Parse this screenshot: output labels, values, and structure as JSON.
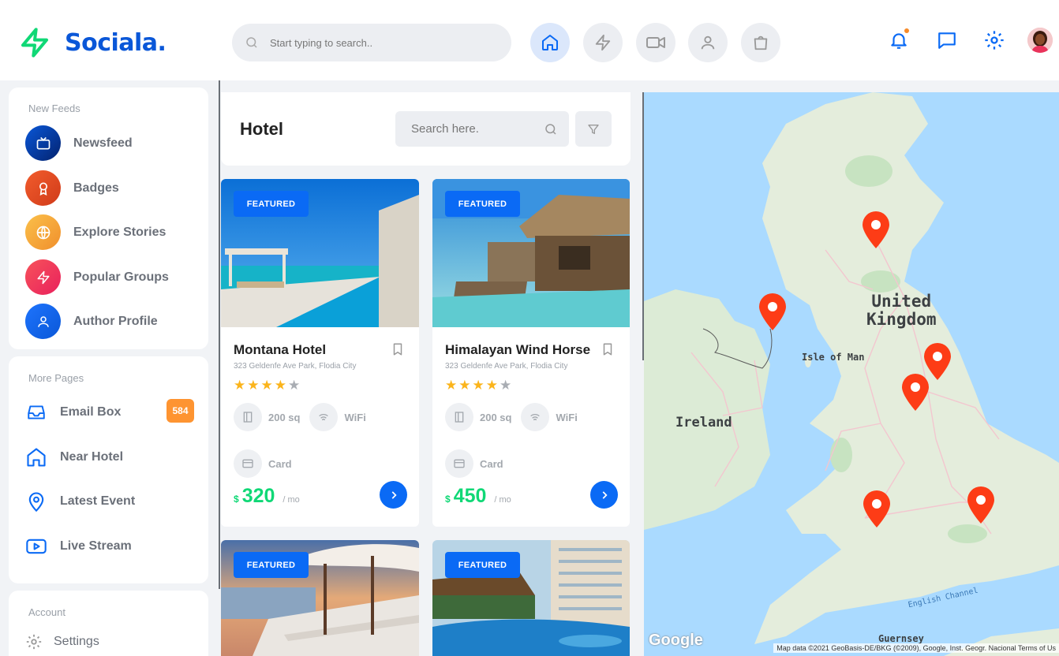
{
  "app": {
    "name": "Sociala.",
    "search_placeholder": "Start typing to search.."
  },
  "header_nav": [
    {
      "icon": "home-icon",
      "active": true
    },
    {
      "icon": "lightning-icon",
      "active": false
    },
    {
      "icon": "video-icon",
      "active": false
    },
    {
      "icon": "user-icon",
      "active": false
    },
    {
      "icon": "shopping-bag-icon",
      "active": false
    }
  ],
  "sidebar": {
    "feeds_title": "New Feeds",
    "feeds": [
      {
        "label": "Newsfeed",
        "icon": "tv-icon",
        "color": "#0a57d8"
      },
      {
        "label": "Badges",
        "icon": "award-icon",
        "color": "#e44d26"
      },
      {
        "label": "Explore Stories",
        "icon": "globe-icon",
        "color": "#f7a23a"
      },
      {
        "label": "Popular Groups",
        "icon": "zap-icon",
        "color": "#f0315f"
      },
      {
        "label": "Author Profile",
        "icon": "user-icon",
        "color": "#1e74fd"
      }
    ],
    "pages_title": "More Pages",
    "pages": [
      {
        "label": "Email Box",
        "icon": "inbox-icon",
        "badge": "584"
      },
      {
        "label": "Near Hotel",
        "icon": "home-icon"
      },
      {
        "label": "Latest Event",
        "icon": "map-pin-icon"
      },
      {
        "label": "Live Stream",
        "icon": "youtube-icon"
      }
    ],
    "account_title": "Account",
    "account": [
      {
        "label": "Settings",
        "icon": "settings-icon"
      }
    ]
  },
  "hotels_panel": {
    "title": "Hotel",
    "search_placeholder": "Search here."
  },
  "hotels": [
    {
      "featured": "FEATURED",
      "name": "Montana Hotel",
      "address": "323 Geldenfe Ave Park, Flodia City",
      "rating": 4,
      "size": "200 sq",
      "wifi": "WiFi",
      "payment": "Card",
      "currency": "$",
      "price": "320",
      "per": "/ mo"
    },
    {
      "featured": "FEATURED",
      "name": "Himalayan Wind Horse",
      "address": "323 Geldenfe Ave Park, Flodia City",
      "rating": 4,
      "size": "200 sq",
      "wifi": "WiFi",
      "payment": "Card",
      "currency": "$",
      "price": "450",
      "per": "/ mo"
    },
    {
      "featured": "FEATURED"
    },
    {
      "featured": "FEATURED"
    }
  ],
  "map": {
    "labels": {
      "uk": "United\nKingdom",
      "ireland": "Ireland",
      "isle_of_man": "Isle of Man",
      "guernsey": "Guernsey",
      "english_channel": "English Channel"
    },
    "google": "Google",
    "attribution": "Map data ©2021 GeoBasis-DE/BKG (©2009), Google, Inst. Geogr. Nacional    Terms of Us"
  },
  "colors": {
    "brand": "#0a57d8",
    "primary": "#0a6af5",
    "price_green": "#10d876",
    "pin": "#fd3c16",
    "badge_orange": "#fe9431"
  }
}
